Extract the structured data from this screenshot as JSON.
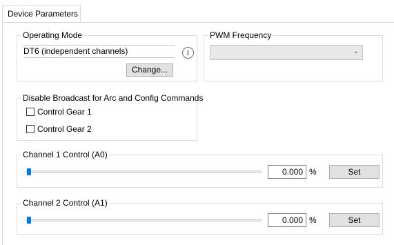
{
  "tab": {
    "label": "Device Parameters"
  },
  "operating_mode": {
    "legend": "Operating Mode",
    "value": "DT6 (independent channels)",
    "info_icon": "info-icon",
    "change_label": "Change..."
  },
  "pwm": {
    "legend": "PWM Frequency",
    "selected": "",
    "dropdown_icon": "chevron-down-icon",
    "chevron": "⌄"
  },
  "broadcast": {
    "legend": "Disable Broadcast for Arc and Config Commands",
    "items": [
      {
        "label": "Control Gear 1",
        "checked": false
      },
      {
        "label": "Control Gear 2",
        "checked": false
      }
    ]
  },
  "channels": [
    {
      "legend": "Channel 1 Control (A0)",
      "value": "0.000",
      "unit": "%",
      "set_label": "Set",
      "slider_level": 0
    },
    {
      "legend": "Channel 2 Control (A1)",
      "value": "0.000",
      "unit": "%",
      "set_label": "Set",
      "slider_level": 0
    }
  ],
  "colors": {
    "accent": "#0078d7",
    "border": "#dcdcdc",
    "button_bg": "#e1e1e1"
  }
}
